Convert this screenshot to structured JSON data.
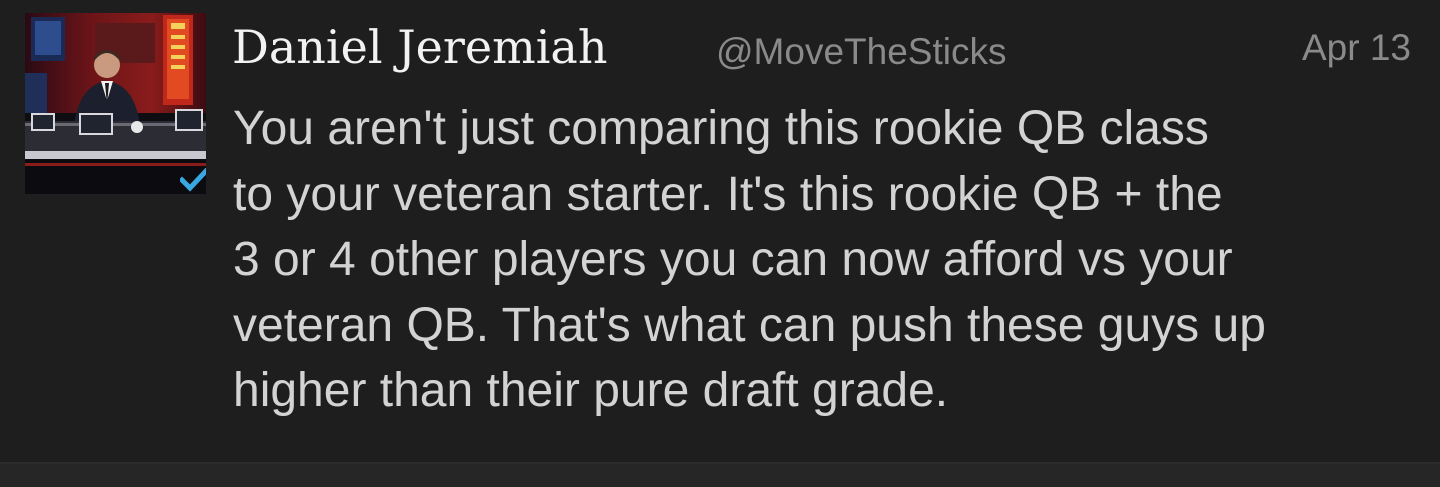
{
  "tweet": {
    "author_name": "Daniel Jeremiah",
    "handle": "@MoveTheSticks",
    "timestamp": "Apr 13",
    "verified": true,
    "text_lines": [
      "You aren't just comparing this rookie QB class",
      "to your veteran starter. It's this rookie QB + the",
      "3 or 4 other players you can now afford vs your",
      "veteran QB. That's what can push these guys up",
      "higher than their pure draft grade."
    ]
  },
  "icons": {
    "avatar": "profile-photo",
    "verified": "verified-check-icon"
  },
  "colors": {
    "background": "#1e1e1e",
    "name": "#f2f2f2",
    "meta": "#8a8a8a",
    "body_text": "#d3d3d3",
    "verified": "#3aa8e0"
  }
}
